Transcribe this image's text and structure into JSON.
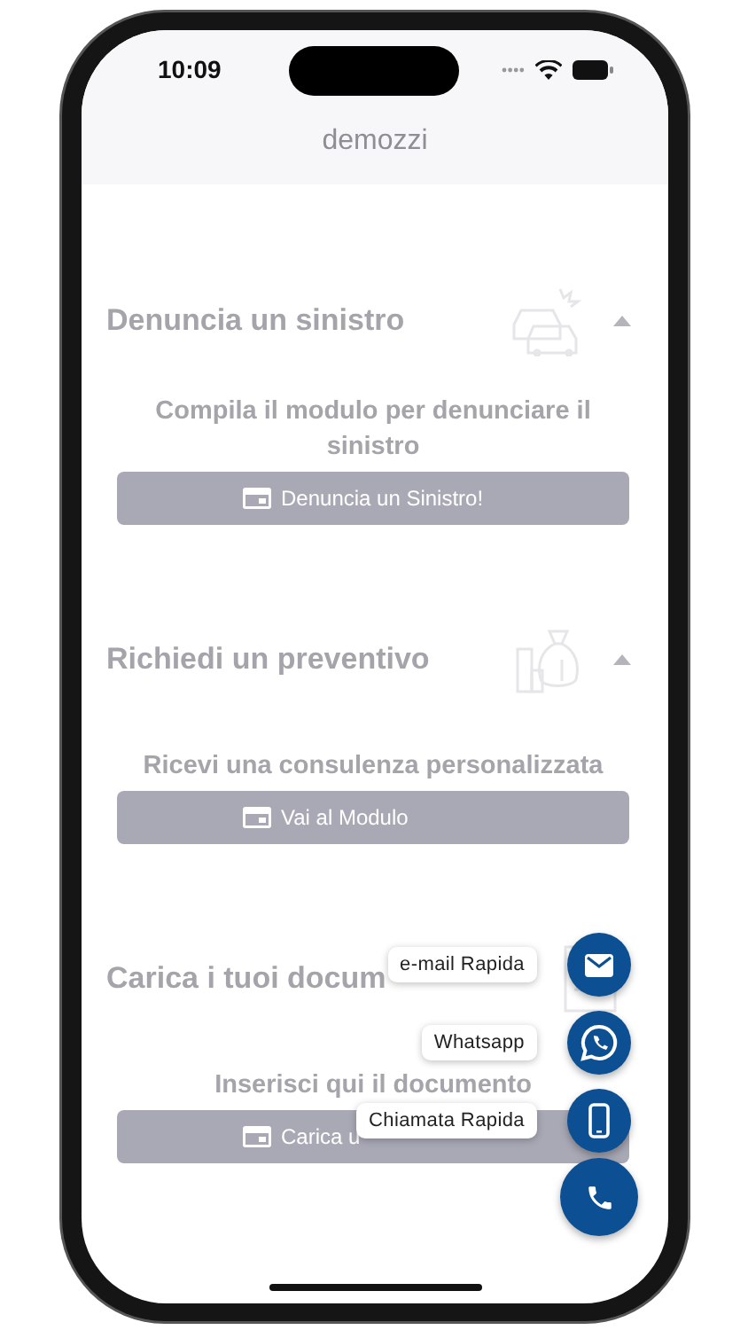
{
  "status_bar": {
    "time": "10:09"
  },
  "header": {
    "title": "demozzi"
  },
  "sections": [
    {
      "title": "Denuncia un sinistro",
      "expanded": true,
      "description": "Compila il modulo per denunciare il sinistro",
      "button": "Denuncia un Sinistro!"
    },
    {
      "title": "Richiedi un preventivo",
      "expanded": true,
      "description": "Ricevi una consulenza personalizzata",
      "button": "Vai al Modulo"
    },
    {
      "title": "Carica i tuoi docum",
      "description": "Inserisci qui il documento",
      "button": "Carica u"
    }
  ],
  "speed_dial": {
    "main": {
      "kind": "phone"
    },
    "actions": [
      {
        "kind": "email",
        "label": "e-mail Rapida"
      },
      {
        "kind": "whatsapp",
        "label": "Whatsapp"
      },
      {
        "kind": "mobile",
        "label": "Chiamata Rapida"
      }
    ]
  }
}
